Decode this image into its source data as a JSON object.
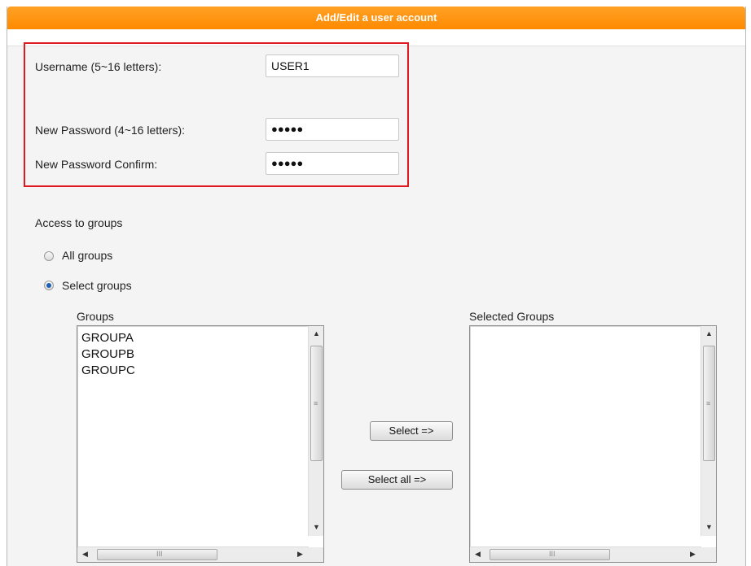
{
  "window": {
    "title": "Add/Edit a user account"
  },
  "account": {
    "username_label": "Username (5~16 letters):",
    "username_value": "USER1",
    "password_label": "New Password (4~16 letters):",
    "password_value": "●●●●●",
    "confirm_label": "New Password Confirm:",
    "confirm_value": "●●●●●"
  },
  "access": {
    "heading": "Access to groups",
    "options": [
      {
        "label": "All groups",
        "selected": false
      },
      {
        "label": "Select groups",
        "selected": true
      }
    ]
  },
  "groups": {
    "available_label": "Groups",
    "available_items": [
      "GROUPA",
      "GROUPB",
      "GROUPC"
    ],
    "selected_label": "Selected Groups",
    "selected_items": []
  },
  "buttons": {
    "select": "Select =>",
    "select_all": "Select all =>"
  },
  "scroll_glyphs": {
    "up": "▲",
    "down": "▼",
    "left": "◀",
    "right": "▶",
    "vgrip": "≡",
    "hgrip": "III"
  },
  "colors": {
    "title_bar": "#ff8a00",
    "highlight_border": "#e0191f",
    "panel_bg": "#f4f4f4"
  }
}
